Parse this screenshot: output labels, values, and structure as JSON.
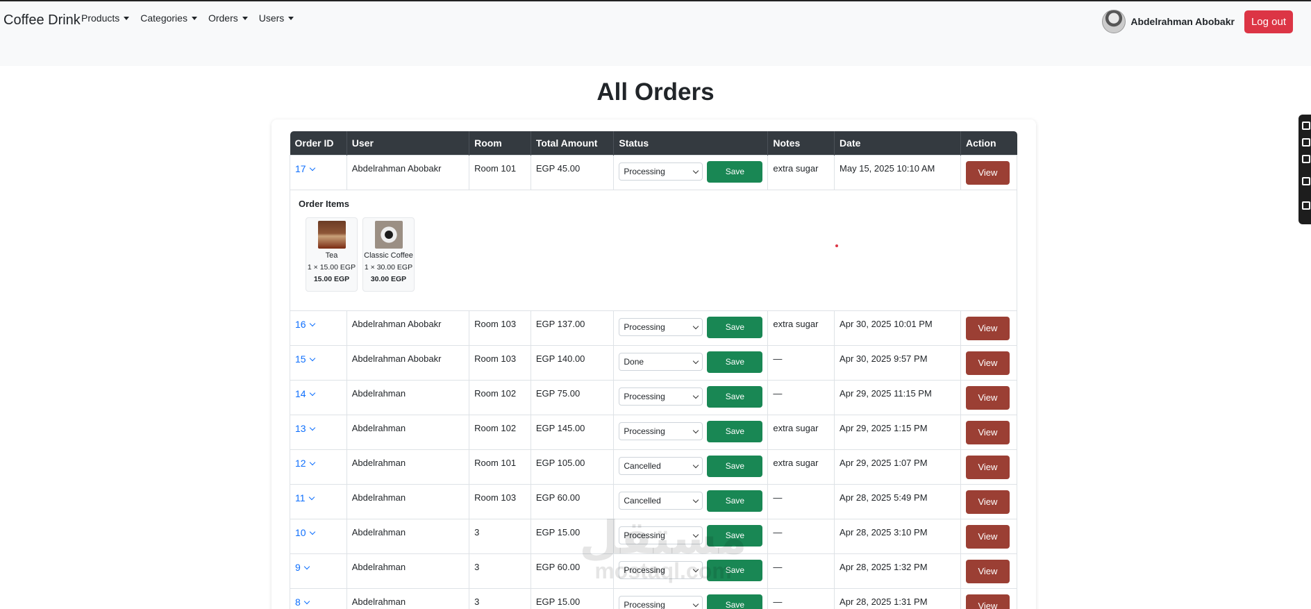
{
  "navbar": {
    "brand": "Coffee Drink",
    "menu": [
      {
        "label": "Products"
      },
      {
        "label": "Categories"
      },
      {
        "label": "Orders"
      },
      {
        "label": "Users"
      }
    ],
    "username": "Abdelrahman Abobakr",
    "logout_label": "Log out"
  },
  "page": {
    "title": "All Orders"
  },
  "table": {
    "headers": [
      "Order ID",
      "User",
      "Room",
      "Total Amount",
      "Status",
      "Notes",
      "Date",
      "Action"
    ],
    "save_label": "Save",
    "view_label": "View",
    "rows": [
      {
        "id": "17",
        "user": "Abdelrahman Abobakr",
        "room": "Room 101",
        "total": "EGP 45.00",
        "status": "Processing",
        "notes": "extra sugar",
        "date": "May 15, 2025 10:10 AM"
      },
      {
        "id": "16",
        "user": "Abdelrahman Abobakr",
        "room": "Room 103",
        "total": "EGP 137.00",
        "status": "Processing",
        "notes": "extra sugar",
        "date": "Apr 30, 2025 10:01 PM"
      },
      {
        "id": "15",
        "user": "Abdelrahman Abobakr",
        "room": "Room 103",
        "total": "EGP 140.00",
        "status": "Done",
        "notes": "—",
        "date": "Apr 30, 2025 9:57 PM"
      },
      {
        "id": "14",
        "user": "Abdelrahman",
        "room": "Room 102",
        "total": "EGP 75.00",
        "status": "Processing",
        "notes": "—",
        "date": "Apr 29, 2025 11:15 PM"
      },
      {
        "id": "13",
        "user": "Abdelrahman",
        "room": "Room 102",
        "total": "EGP 145.00",
        "status": "Processing",
        "notes": "extra sugar",
        "date": "Apr 29, 2025 1:15 PM"
      },
      {
        "id": "12",
        "user": "Abdelrahman",
        "room": "Room 101",
        "total": "EGP 105.00",
        "status": "Cancelled",
        "notes": "extra sugar",
        "date": "Apr 29, 2025 1:07 PM"
      },
      {
        "id": "11",
        "user": "Abdelrahman",
        "room": "Room 103",
        "total": "EGP 60.00",
        "status": "Cancelled",
        "notes": "—",
        "date": "Apr 28, 2025 5:49 PM"
      },
      {
        "id": "10",
        "user": "Abdelrahman",
        "room": "3",
        "total": "EGP 15.00",
        "status": "Processing",
        "notes": "—",
        "date": "Apr 28, 2025 3:10 PM"
      },
      {
        "id": "9",
        "user": "Abdelrahman",
        "room": "3",
        "total": "EGP 60.00",
        "status": "Processing",
        "notes": "—",
        "date": "Apr 28, 2025 1:32 PM"
      },
      {
        "id": "8",
        "user": "Abdelrahman",
        "room": "3",
        "total": "EGP 15.00",
        "status": "Processing",
        "notes": "—",
        "date": "Apr 28, 2025 1:31 PM"
      }
    ],
    "expanded": {
      "heading": "Order Items",
      "items": [
        {
          "name": "Tea",
          "qty": "1 × 15.00 EGP",
          "total": "15.00 EGP",
          "icon": "tea-image"
        },
        {
          "name": "Classic Coffee",
          "qty": "1 × 30.00 EGP",
          "total": "30.00 EGP",
          "icon": "coffee-image"
        }
      ]
    }
  },
  "watermark": {
    "arabic": "مستقل",
    "latin": "mostaql.com"
  },
  "colors": {
    "save": "#198754",
    "view": "#9b3f34",
    "logout": "#dc3545",
    "header": "#343a40",
    "link": "#0d6efd"
  }
}
